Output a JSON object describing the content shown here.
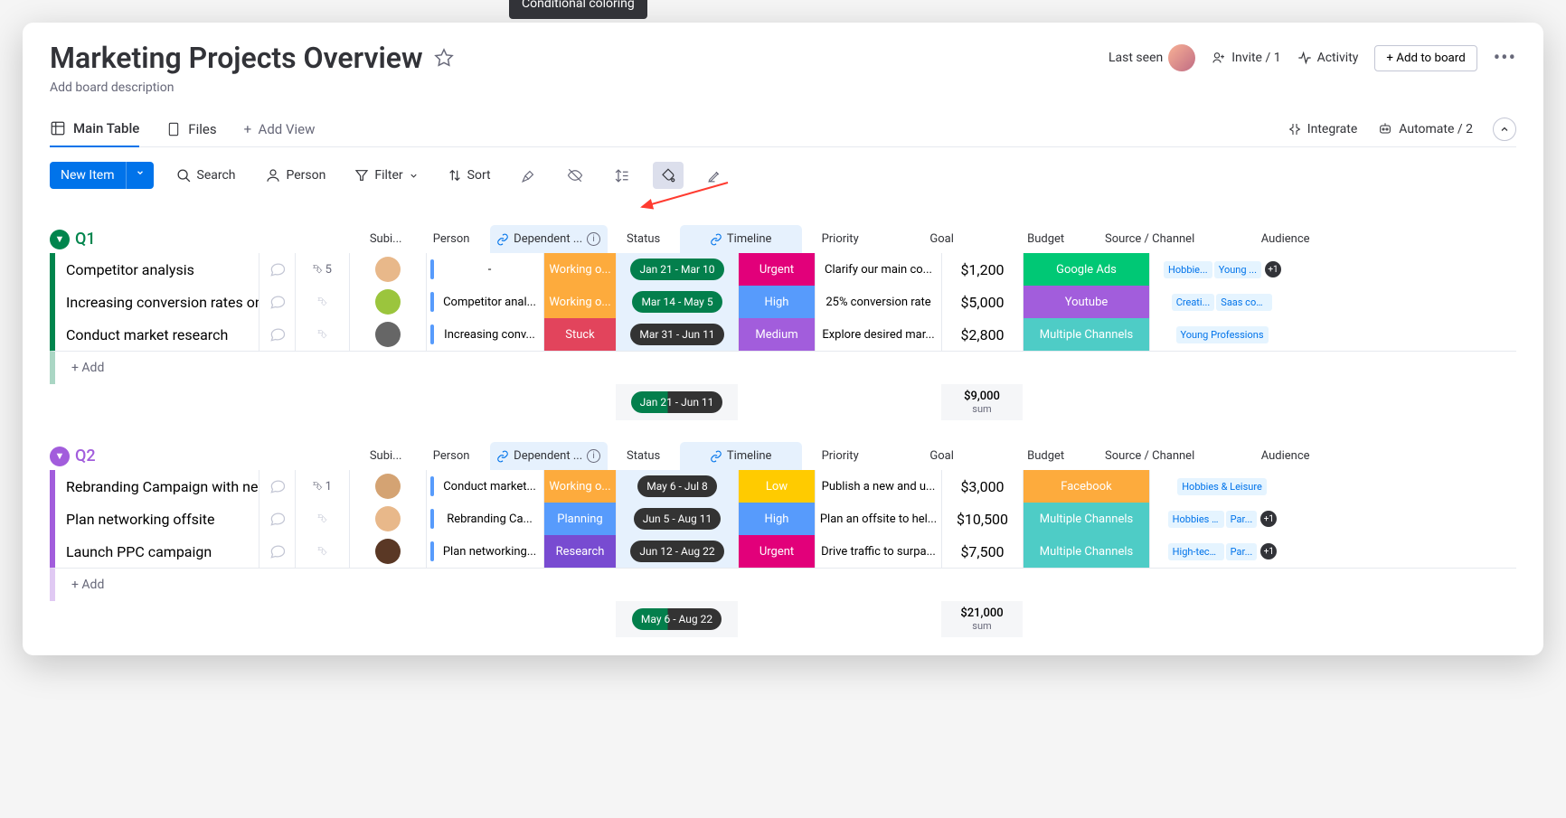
{
  "board": {
    "title": "Marketing Projects Overview",
    "description": "Add board description",
    "last_seen": "Last seen",
    "invite": "Invite / 1",
    "activity": "Activity",
    "add_to_board": "Add to board"
  },
  "tabs": {
    "main_table": "Main Table",
    "files": "Files",
    "add_view": "Add View",
    "integrate": "Integrate",
    "automate": "Automate / 2"
  },
  "toolbar": {
    "new_item": "New Item",
    "search": "Search",
    "person": "Person",
    "filter": "Filter",
    "sort": "Sort"
  },
  "tooltip": "Conditional coloring",
  "columns": {
    "subitems": "Subi...",
    "person": "Person",
    "dependent": "Dependent ...",
    "status": "Status",
    "timeline": "Timeline",
    "priority": "Priority",
    "goal": "Goal",
    "budget": "Budget",
    "source": "Source / Channel",
    "audience": "Audience"
  },
  "groups": [
    {
      "name": "Q1",
      "color": "#00854d",
      "rows": [
        {
          "name": "Competitor analysis",
          "sub": "5",
          "person": "#e8b88a",
          "dep": "-",
          "dep_color": "#579bfc",
          "status": "Working o...",
          "status_color": "#fdab3d",
          "timeline": "Jan 21 - Mar 10",
          "timeline_bg": "#037f4c",
          "priority": "Urgent",
          "priority_color": "#e2007a",
          "goal": "Clarify our main co...",
          "budget": "$1,200",
          "source": "Google Ads",
          "source_color": "#00c875",
          "aud": [
            "Hobbie...",
            "Young ..."
          ],
          "aud_more": "+1"
        },
        {
          "name": "Increasing conversion rates on lan...",
          "sub": "",
          "person": "#9bc53d",
          "dep": "Competitor anal...",
          "dep_color": "#579bfc",
          "status": "Working o...",
          "status_color": "#fdab3d",
          "timeline": "Mar 14 - May 5",
          "timeline_bg": "#037f4c",
          "priority": "High",
          "priority_color": "#579bfc",
          "goal": "25% conversion rate",
          "budget": "$5,000",
          "source": "Youtube",
          "source_color": "#a25ddc",
          "aud": [
            "Creati...",
            "Saas compa..."
          ],
          "aud_more": ""
        },
        {
          "name": "Conduct market research",
          "sub": "",
          "person": "#666",
          "dep": "Increasing conv...",
          "dep_color": "#579bfc",
          "status": "Stuck",
          "status_color": "#e2445c",
          "timeline": "Mar 31 - Jun 11",
          "timeline_bg": "#333333",
          "priority": "Medium",
          "priority_color": "#a25ddc",
          "goal": "Explore desired mar...",
          "budget": "$2,800",
          "source": "Multiple Channels",
          "source_color": "#4eccc6",
          "aud": [
            "Young Professions"
          ],
          "aud_more": ""
        }
      ],
      "summary_timeline": "Jan 21 - Jun 11",
      "summary_budget": "$9,000",
      "summary_label": "sum",
      "add": "+ Add"
    },
    {
      "name": "Q2",
      "color": "#a25ddc",
      "rows": [
        {
          "name": "Rebranding Campaign with new lo...",
          "sub": "1",
          "person": "#d4a373",
          "dep": "Conduct market...",
          "dep_color": "#579bfc",
          "status": "Working o...",
          "status_color": "#fdab3d",
          "timeline": "May 6 - Jul 8",
          "timeline_bg": "#333333",
          "priority": "Low",
          "priority_color": "#ffcb00",
          "goal": "Publish a new and u...",
          "budget": "$3,000",
          "source": "Facebook",
          "source_color": "#fdab3d",
          "aud": [
            "Hobbies & Leisure"
          ],
          "aud_more": ""
        },
        {
          "name": "Plan networking offsite",
          "sub": "",
          "person": "#e8b88a",
          "dep": "Rebranding Ca...",
          "dep_color": "#579bfc",
          "status": "Planning",
          "status_color": "#579bfc",
          "timeline": "Jun 5 - Aug 11",
          "timeline_bg": "#333333",
          "priority": "High",
          "priority_color": "#579bfc",
          "goal": "Plan an offsite to hel...",
          "budget": "$10,500",
          "source": "Multiple Channels",
          "source_color": "#4eccc6",
          "aud": [
            "Hobbies & ...",
            "Par..."
          ],
          "aud_more": "+1"
        },
        {
          "name": "Launch PPC campaign",
          "sub": "",
          "person": "#5a3825",
          "dep": "Plan networking...",
          "dep_color": "#579bfc",
          "status": "Research",
          "status_color": "#784bd1",
          "timeline": "Jun 12 - Aug 22",
          "timeline_bg": "#333333",
          "priority": "Urgent",
          "priority_color": "#e2007a",
          "goal": "Drive traffic to surpa...",
          "budget": "$7,500",
          "source": "Multiple Channels",
          "source_color": "#4eccc6",
          "aud": [
            "High-tech In...",
            "Par..."
          ],
          "aud_more": "+1"
        }
      ],
      "summary_timeline": "May 6 - Aug 22",
      "summary_budget": "$21,000",
      "summary_label": "sum",
      "add": "+ Add"
    }
  ]
}
